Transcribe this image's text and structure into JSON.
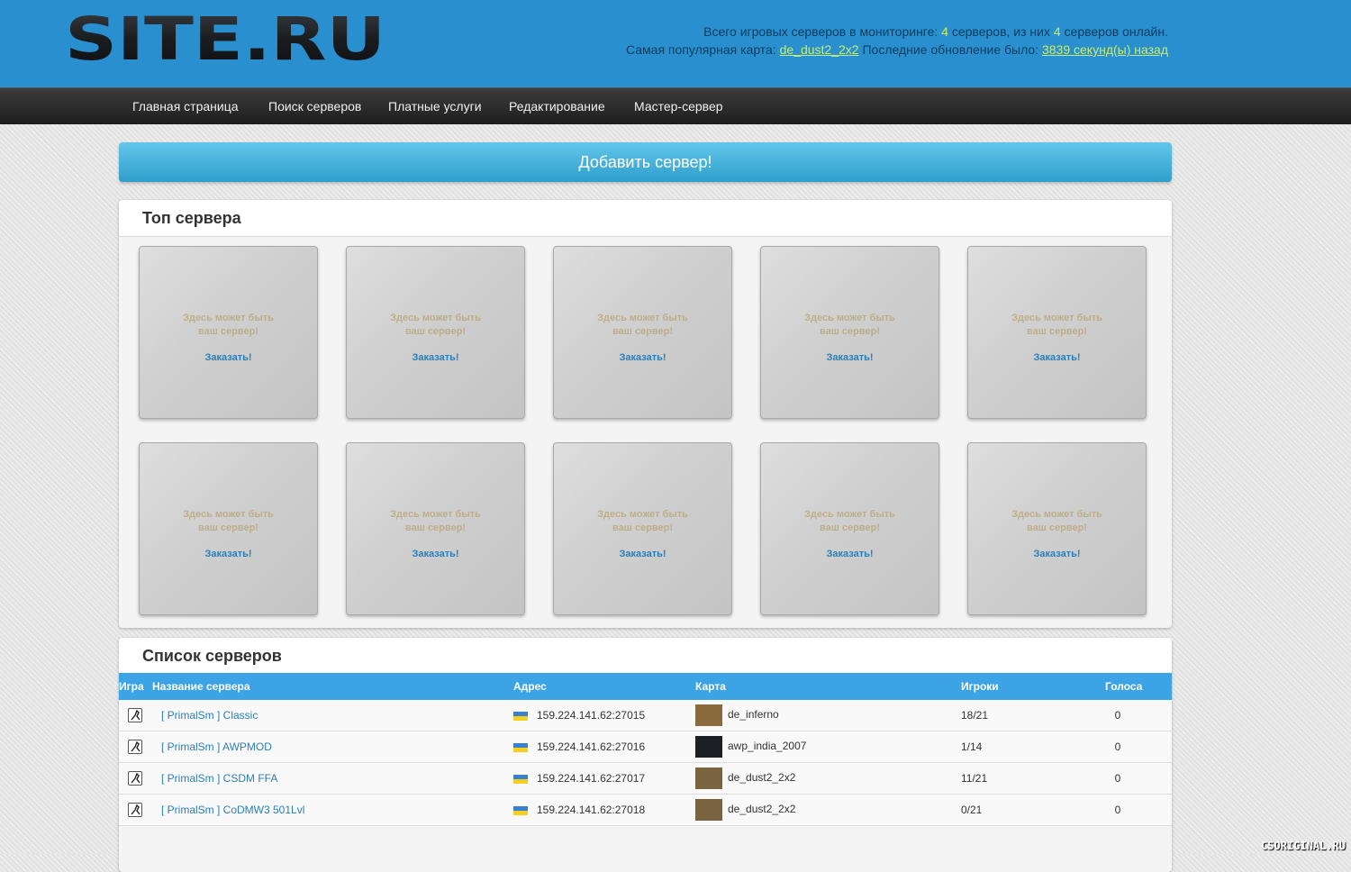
{
  "header": {
    "logo_text": "SITE.RU",
    "stats_line1_a": "Всего игровых серверов в мониторинге:",
    "total_servers": "4",
    "stats_line1_b": "серверов, из них",
    "online_servers": "4",
    "stats_line1_c": "серверов онлайн.",
    "stats_line2_a": "Самая популярная карта:",
    "popular_map": "de_dust2_2x2",
    "stats_line2_b": "Последние обновление было:",
    "last_update": "3839 секунд(ы) назад"
  },
  "nav": [
    {
      "label": "Главная страница"
    },
    {
      "label": "Поиск серверов"
    },
    {
      "label": "Платные услуги"
    },
    {
      "label": "Редактирование"
    },
    {
      "label": "Мастер-сервер"
    }
  ],
  "add_server_label": "Добавить сервер!",
  "top_servers": {
    "title": "Топ сервера",
    "slot_line1": "Здесь может быть",
    "slot_line2": "ваш сервер!",
    "order_label": "Заказать!"
  },
  "server_list": {
    "title": "Список серверов",
    "columns": [
      "Игра",
      "Название сервера",
      "Адрес",
      "Карта",
      "Игроки",
      "Голоса"
    ],
    "rows": [
      {
        "name": "[ PrimalSm ] Classic",
        "address": "159.224.141.62:27015",
        "map": "de_inferno",
        "players": "18/21",
        "votes": "0"
      },
      {
        "name": "[ PrimalSm ] AWPMOD",
        "address": "159.224.141.62:27016",
        "map": "awp_india_2007",
        "players": "1/14",
        "votes": "0"
      },
      {
        "name": "[ PrimalSm ] CSDM FFA",
        "address": "159.224.141.62:27017",
        "map": "de_dust2_2x2",
        "players": "11/21",
        "votes": "0"
      },
      {
        "name": "[ PrimalSm ] CoDMW3 501Lvl",
        "address": "159.224.141.62:27018",
        "map": "de_dust2_2x2",
        "players": "0/21",
        "votes": "0"
      }
    ]
  },
  "watermark": "CSORIGINAL.RU",
  "colors": {
    "header_bg": "#2a8fcf",
    "accent": "#3ca3e4",
    "highlight": "#c9ec6a",
    "link": "#2a7fb8"
  }
}
